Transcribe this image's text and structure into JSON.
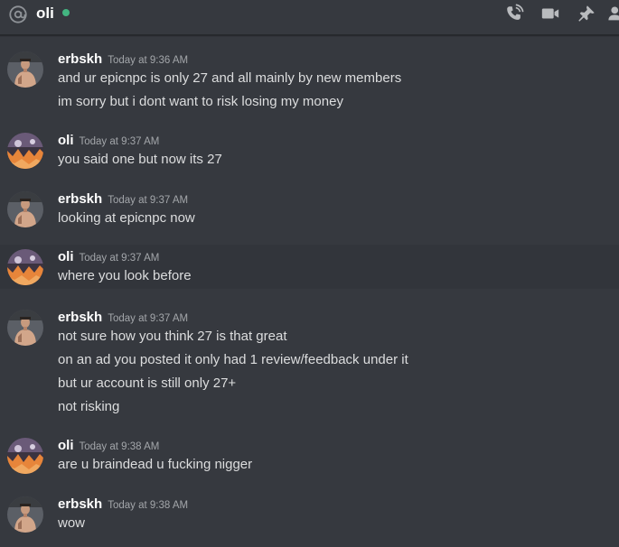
{
  "header": {
    "channel_name": "oli",
    "status_color": "#43b581",
    "icons": [
      "at-icon",
      "phone-call-icon",
      "video-call-icon",
      "pin-icon",
      "members-icon"
    ]
  },
  "messages": [
    {
      "author": "erbskh",
      "timestamp": "Today at 9:36 AM",
      "avatar": "erbskh-avatar",
      "lines": [
        "and ur epicnpc is only 27 and all mainly by new members",
        "im sorry but i dont want to risk losing my money"
      ]
    },
    {
      "author": "oli",
      "timestamp": "Today at 9:37 AM",
      "avatar": "oli-avatar",
      "lines": [
        "you said one but now its 27"
      ]
    },
    {
      "author": "erbskh",
      "timestamp": "Today at 9:37 AM",
      "avatar": "erbskh-avatar",
      "lines": [
        "looking at epicnpc now"
      ]
    },
    {
      "author": "oli",
      "timestamp": "Today at 9:37 AM",
      "avatar": "oli-avatar",
      "lines": [
        "where you look before"
      ]
    },
    {
      "author": "erbskh",
      "timestamp": "Today at 9:37 AM",
      "avatar": "erbskh-avatar",
      "lines": [
        "not sure how you think 27 is that great",
        "on an ad you posted it only had 1 review/feedback under it",
        "but ur account is still only 27+",
        "not risking"
      ]
    },
    {
      "author": "oli",
      "timestamp": "Today at 9:38 AM",
      "avatar": "oli-avatar",
      "lines": [
        "are u braindead u fucking nigger"
      ]
    },
    {
      "author": "erbskh",
      "timestamp": "Today at 9:38 AM",
      "avatar": "erbskh-avatar",
      "lines": [
        "wow"
      ]
    }
  ]
}
